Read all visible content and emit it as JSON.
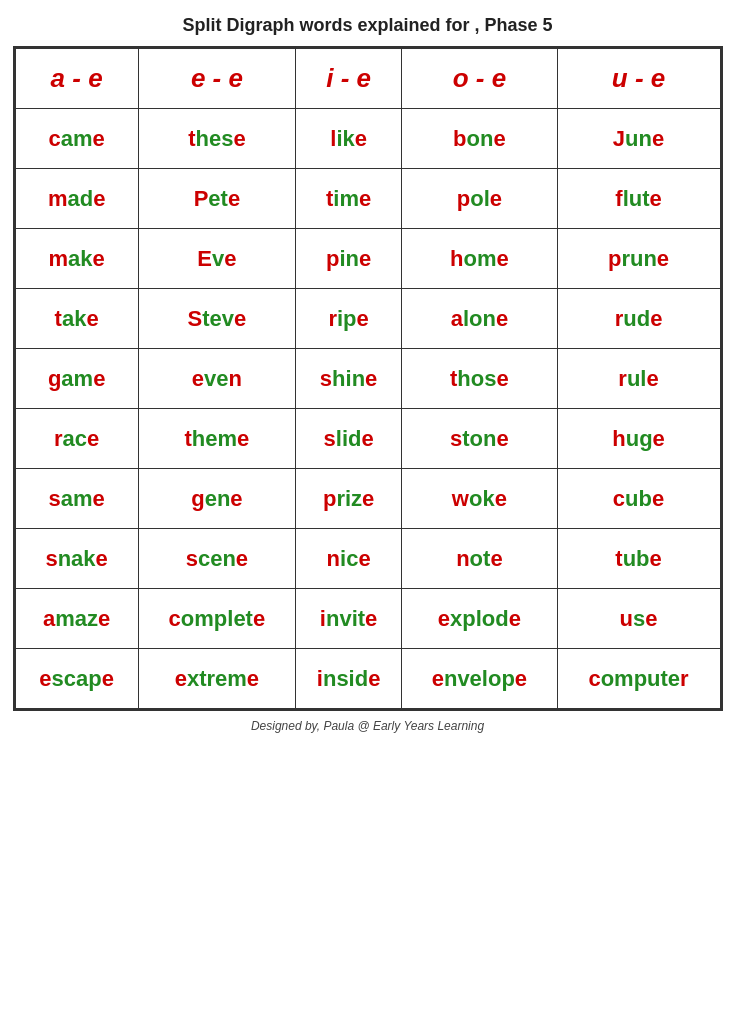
{
  "title": "Split Digraph words explained for , Phase 5",
  "headers": [
    "a - e",
    "e - e",
    "i - e",
    "o - e",
    "u - e"
  ],
  "rows": [
    [
      "came",
      "these",
      "like",
      "bone",
      "June"
    ],
    [
      "made",
      "Pete",
      "time",
      "pole",
      "flute"
    ],
    [
      "make",
      "Eve",
      "pine",
      "home",
      "prune"
    ],
    [
      "take",
      "Steve",
      "ripe",
      "alone",
      "rude"
    ],
    [
      "game",
      "even",
      "shine",
      "those",
      "rule"
    ],
    [
      "race",
      "theme",
      "slide",
      "stone",
      "huge"
    ],
    [
      "same",
      "gene",
      "prize",
      "woke",
      "cube"
    ],
    [
      "snake",
      "scene",
      "nice",
      "note",
      "tube"
    ],
    [
      "amaze",
      "complete",
      "invite",
      "explode",
      "use"
    ],
    [
      "escape",
      "extreme",
      "inside",
      "envelope",
      "computer"
    ]
  ],
  "footer": "Designed by, Paula @ Early Years Learning"
}
